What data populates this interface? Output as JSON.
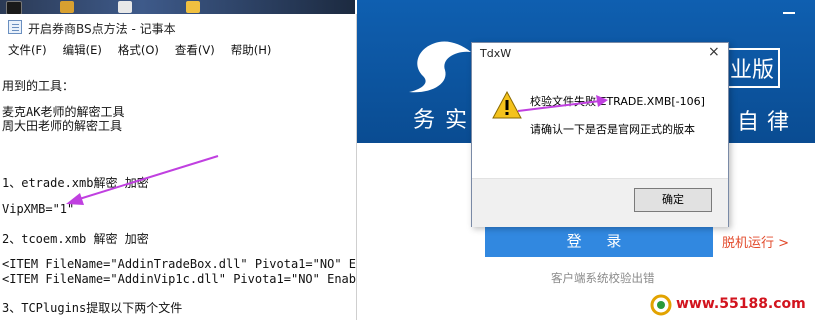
{
  "notepad": {
    "title": "开启券商BS点方法 - 记事本",
    "menu": [
      "文件(F)",
      "编辑(E)",
      "格式(O)",
      "查看(V)",
      "帮助(H)"
    ],
    "lines": [
      "用到的工具：",
      "",
      "麦克AK老师的解密工具",
      "周大田老师的解密工具",
      "",
      "",
      "1、etrade.xmb解密  加密",
      "",
      " VipXMB=\"1\"",
      "",
      "2、tcoem.xmb 解密  加密",
      "",
      "<ITEM FileName=\"AddinTradeBox.dll\" Pivota1=\"NO\" Ena",
      "<ITEM FileName=\"AddinVip1c.dll\" Pivota1=\"NO\" Enable",
      "",
      "3、TCPlugins提取以下两个文件"
    ]
  },
  "tdx": {
    "edition": "业版",
    "slogan_left": "务实",
    "slogan_right": "自律",
    "login_label": "登 录",
    "offline_label": "脱机运行 >",
    "status": "客户端系统校验出错"
  },
  "dialog": {
    "title": "TdxW",
    "close": "×",
    "message1": "校验文件失败 ETRADE.XMB[-106]",
    "message2": "请确认一下是否是官网正式的版本",
    "ok_label": "确定"
  },
  "watermark": {
    "text": "www.55188.com"
  },
  "colors": {
    "banner": "#0f5fb0",
    "login": "#3188e0",
    "offline": "#e24a2b",
    "arrow": "#c040e0"
  }
}
